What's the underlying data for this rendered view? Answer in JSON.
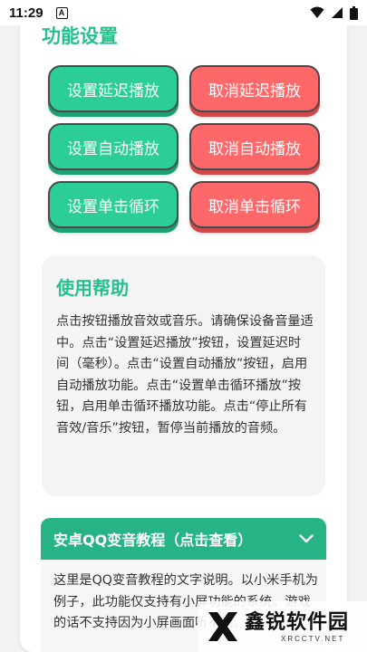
{
  "status_bar": {
    "time": "11:29",
    "notification_letter": "A",
    "icons": [
      "wifi-icon",
      "signal-icon",
      "battery-icon"
    ]
  },
  "settings": {
    "title": "功能设置",
    "buttons": {
      "set_delay": "设置延迟播放",
      "cancel_delay": "取消延迟播放",
      "set_auto": "设置自动播放",
      "cancel_auto": "取消自动播放",
      "set_loop": "设置单击循环",
      "cancel_loop": "取消单击循环"
    }
  },
  "help": {
    "title": "使用帮助",
    "text": "点击按钮播放音效或音乐。请确保设备音量适中。点击“设置延迟播放”按钮，设置延迟时间（毫秒）。点击“设置自动播放”按钮，启用自动播放功能。点击“设置单击循环播放”按钮，启用单击循环播放功能。点击“停止所有音效/音乐”按钮，暂停当前播放的音频。"
  },
  "tutorial": {
    "header": "安卓QQ变音教程（点击查看）",
    "text": "这里是QQ变音教程的文字说明。以小米手机为例子，此功能仅支持有小屏功能的系统。游戏的话不支持因为小屏画面听不到。"
  },
  "watermark": {
    "brand": "鑫锐软件园",
    "domain": "XRCCTV.NET"
  },
  "colors": {
    "accent_green": "#26c08f",
    "button_green": "#2bcf96",
    "button_red": "#ff6868",
    "accordion_header": "#26b386"
  }
}
